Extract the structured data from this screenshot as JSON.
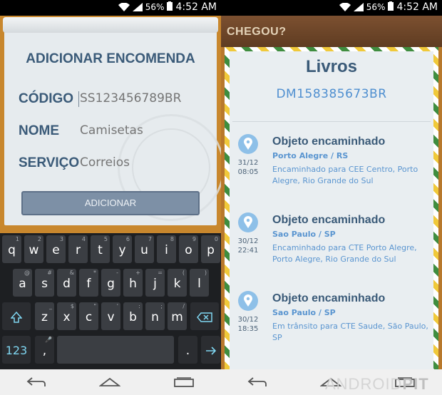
{
  "status_bar": {
    "battery": "56%",
    "time": "4:52 AM"
  },
  "left": {
    "form_title": "ADICIONAR ENCOMENDA",
    "fields": [
      {
        "label": "CÓDIGO",
        "placeholder": "SS123456789BR",
        "value": ""
      },
      {
        "label": "NOME",
        "placeholder": "Camisetas",
        "value": ""
      },
      {
        "label": "SERVIÇO",
        "placeholder": "Correios",
        "value": ""
      }
    ],
    "add_button": "ADICIONAR",
    "keyboard": {
      "row1": [
        "q",
        "w",
        "e",
        "r",
        "t",
        "y",
        "u",
        "i",
        "o",
        "p"
      ],
      "row1_sub": [
        "1",
        "2",
        "3",
        "4",
        "5",
        "6",
        "7",
        "8",
        "9",
        "0"
      ],
      "row2": [
        "a",
        "s",
        "d",
        "f",
        "g",
        "h",
        "j",
        "k",
        "l"
      ],
      "row2_sub": [
        "@",
        "#",
        "&",
        "*",
        "-",
        "+",
        "=",
        "(",
        ")"
      ],
      "row3": [
        "z",
        "x",
        "c",
        "v",
        "b",
        "n",
        "m"
      ],
      "row3_sub": [
        "_",
        "$",
        "\"",
        "'",
        ":",
        ";",
        "/"
      ],
      "sym_key": "123",
      "comma": ",",
      "period": "."
    }
  },
  "right": {
    "app_title": "CHEGOU?",
    "item_title": "Livros",
    "tracking_code": "DM158385673BR",
    "events": [
      {
        "title": "Objeto encaminhado",
        "place": "Porto Alegre / RS",
        "date": "31/12",
        "time": "08:05",
        "desc": "Encaminhado para CEE Centro, Porto Alegre, Rio Grande do Sul"
      },
      {
        "title": "Objeto encaminhado",
        "place": "Sao Paulo / SP",
        "date": "30/12",
        "time": "22:41",
        "desc": "Encaminhado para CTE Porto Alegre, Porto Alegre, Rio Grande do Sul"
      },
      {
        "title": "Objeto encaminhado",
        "place": "Sao Paulo / SP",
        "date": "30/12",
        "time": "18:35",
        "desc": "Em trânsito para CTE Saude, São Paulo, SP"
      }
    ]
  },
  "watermark": {
    "part1": "ANDROID",
    "part2": "PIT"
  }
}
